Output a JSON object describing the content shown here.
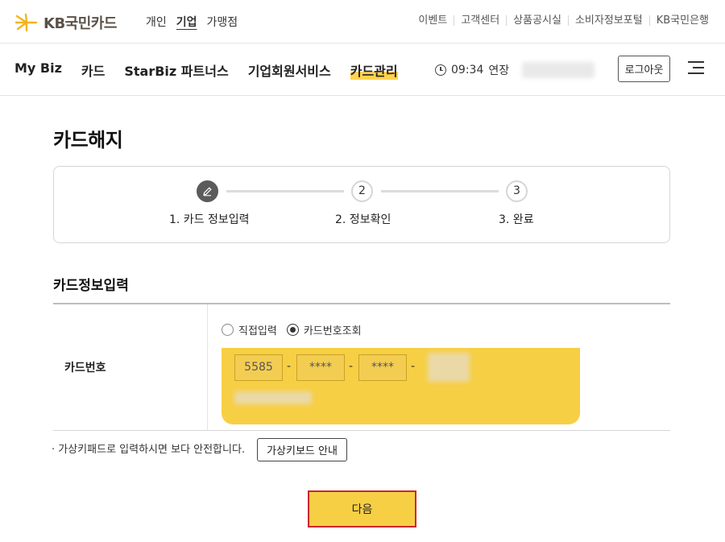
{
  "brand": {
    "logo_text": "KB국민카드",
    "accent": "#f7cf45"
  },
  "segments": [
    {
      "label": "개인"
    },
    {
      "label": "기업",
      "active": true
    },
    {
      "label": "가맹점"
    }
  ],
  "utility_links": [
    "이벤트",
    "고객센터",
    "상품공시실",
    "소비자정보포털",
    "KB국민은행"
  ],
  "main_nav": [
    {
      "label": "My Biz"
    },
    {
      "label": "카드"
    },
    {
      "label": "StarBiz 파트너스"
    },
    {
      "label": "기업회원서비스"
    },
    {
      "label": "카드관리",
      "active": true
    }
  ],
  "session": {
    "time": "09:34",
    "extend_label": "연장"
  },
  "logout_label": "로그아웃",
  "page_title": "카드해지",
  "steps": [
    {
      "number": "",
      "label": "1. 카드 정보입력",
      "current": true
    },
    {
      "number": "2",
      "label": "2. 정보확인"
    },
    {
      "number": "3",
      "label": "3. 완료"
    }
  ],
  "section_title": "카드정보입력",
  "form": {
    "card_number_label": "카드번호",
    "radio_options": [
      {
        "label": "직접입력",
        "checked": false
      },
      {
        "label": "카드번호조회",
        "checked": true
      }
    ],
    "card_segments": [
      "5585",
      "****",
      "****",
      ""
    ],
    "separator": "-"
  },
  "notice": "· 가상키패드로 입력하시면 보다 안전합니다.",
  "virtual_keyboard_button": "가상키보드 안내",
  "next_button": "다음"
}
